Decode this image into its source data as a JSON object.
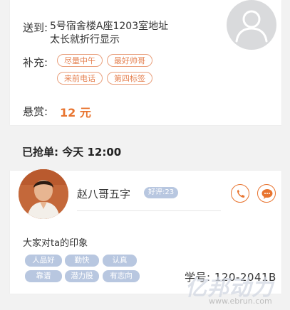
{
  "order": {
    "deliver_label": "送到:",
    "address_line1": "5号宿舍楼A座1203室地址",
    "address_line2": "太长就折行显示",
    "extra_label": "补充:",
    "tags": [
      "尽量中午",
      "最好帅哥",
      "来前电话",
      "第四标签"
    ],
    "bounty_label": "悬赏:",
    "bounty_value": "12 元"
  },
  "grabbed": {
    "title": "已抢单:  今天 12:00"
  },
  "taker": {
    "name": "赵八哥五字",
    "rating": "好评:23",
    "impression_title": "大家对ta的印象",
    "impression_tags": [
      "人品好",
      "勤快",
      "认真",
      "靠谱",
      "潜力股",
      "有志向"
    ],
    "student_id": "学号: 120-2041B"
  },
  "watermark": {
    "text": "亿邦动力",
    "url": "www.ebrun.com"
  },
  "colors": {
    "accent": "#e8742f",
    "tag_border": "#e9a07d",
    "pill_bg": "#b8c7e0",
    "background": "#f2f2f2"
  },
  "icons": {
    "avatar": "default-user-avatar-icon",
    "call": "phone-icon",
    "chat": "chat-bubble-icon"
  }
}
